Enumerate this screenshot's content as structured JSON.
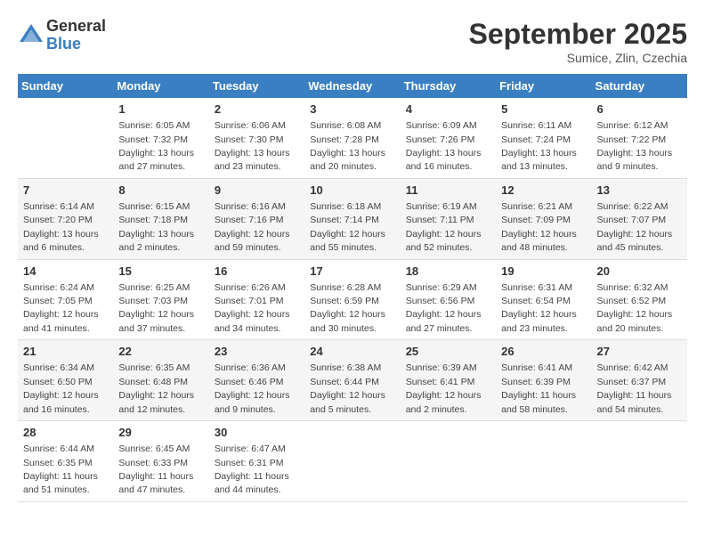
{
  "logo": {
    "general": "General",
    "blue": "Blue"
  },
  "title": "September 2025",
  "location": "Sumice, Zlin, Czechia",
  "days_of_week": [
    "Sunday",
    "Monday",
    "Tuesday",
    "Wednesday",
    "Thursday",
    "Friday",
    "Saturday"
  ],
  "weeks": [
    [
      {
        "day": "",
        "info": ""
      },
      {
        "day": "1",
        "info": "Sunrise: 6:05 AM\nSunset: 7:32 PM\nDaylight: 13 hours\nand 27 minutes."
      },
      {
        "day": "2",
        "info": "Sunrise: 6:06 AM\nSunset: 7:30 PM\nDaylight: 13 hours\nand 23 minutes."
      },
      {
        "day": "3",
        "info": "Sunrise: 6:08 AM\nSunset: 7:28 PM\nDaylight: 13 hours\nand 20 minutes."
      },
      {
        "day": "4",
        "info": "Sunrise: 6:09 AM\nSunset: 7:26 PM\nDaylight: 13 hours\nand 16 minutes."
      },
      {
        "day": "5",
        "info": "Sunrise: 6:11 AM\nSunset: 7:24 PM\nDaylight: 13 hours\nand 13 minutes."
      },
      {
        "day": "6",
        "info": "Sunrise: 6:12 AM\nSunset: 7:22 PM\nDaylight: 13 hours\nand 9 minutes."
      }
    ],
    [
      {
        "day": "7",
        "info": "Sunrise: 6:14 AM\nSunset: 7:20 PM\nDaylight: 13 hours\nand 6 minutes."
      },
      {
        "day": "8",
        "info": "Sunrise: 6:15 AM\nSunset: 7:18 PM\nDaylight: 13 hours\nand 2 minutes."
      },
      {
        "day": "9",
        "info": "Sunrise: 6:16 AM\nSunset: 7:16 PM\nDaylight: 12 hours\nand 59 minutes."
      },
      {
        "day": "10",
        "info": "Sunrise: 6:18 AM\nSunset: 7:14 PM\nDaylight: 12 hours\nand 55 minutes."
      },
      {
        "day": "11",
        "info": "Sunrise: 6:19 AM\nSunset: 7:11 PM\nDaylight: 12 hours\nand 52 minutes."
      },
      {
        "day": "12",
        "info": "Sunrise: 6:21 AM\nSunset: 7:09 PM\nDaylight: 12 hours\nand 48 minutes."
      },
      {
        "day": "13",
        "info": "Sunrise: 6:22 AM\nSunset: 7:07 PM\nDaylight: 12 hours\nand 45 minutes."
      }
    ],
    [
      {
        "day": "14",
        "info": "Sunrise: 6:24 AM\nSunset: 7:05 PM\nDaylight: 12 hours\nand 41 minutes."
      },
      {
        "day": "15",
        "info": "Sunrise: 6:25 AM\nSunset: 7:03 PM\nDaylight: 12 hours\nand 37 minutes."
      },
      {
        "day": "16",
        "info": "Sunrise: 6:26 AM\nSunset: 7:01 PM\nDaylight: 12 hours\nand 34 minutes."
      },
      {
        "day": "17",
        "info": "Sunrise: 6:28 AM\nSunset: 6:59 PM\nDaylight: 12 hours\nand 30 minutes."
      },
      {
        "day": "18",
        "info": "Sunrise: 6:29 AM\nSunset: 6:56 PM\nDaylight: 12 hours\nand 27 minutes."
      },
      {
        "day": "19",
        "info": "Sunrise: 6:31 AM\nSunset: 6:54 PM\nDaylight: 12 hours\nand 23 minutes."
      },
      {
        "day": "20",
        "info": "Sunrise: 6:32 AM\nSunset: 6:52 PM\nDaylight: 12 hours\nand 20 minutes."
      }
    ],
    [
      {
        "day": "21",
        "info": "Sunrise: 6:34 AM\nSunset: 6:50 PM\nDaylight: 12 hours\nand 16 minutes."
      },
      {
        "day": "22",
        "info": "Sunrise: 6:35 AM\nSunset: 6:48 PM\nDaylight: 12 hours\nand 12 minutes."
      },
      {
        "day": "23",
        "info": "Sunrise: 6:36 AM\nSunset: 6:46 PM\nDaylight: 12 hours\nand 9 minutes."
      },
      {
        "day": "24",
        "info": "Sunrise: 6:38 AM\nSunset: 6:44 PM\nDaylight: 12 hours\nand 5 minutes."
      },
      {
        "day": "25",
        "info": "Sunrise: 6:39 AM\nSunset: 6:41 PM\nDaylight: 12 hours\nand 2 minutes."
      },
      {
        "day": "26",
        "info": "Sunrise: 6:41 AM\nSunset: 6:39 PM\nDaylight: 11 hours\nand 58 minutes."
      },
      {
        "day": "27",
        "info": "Sunrise: 6:42 AM\nSunset: 6:37 PM\nDaylight: 11 hours\nand 54 minutes."
      }
    ],
    [
      {
        "day": "28",
        "info": "Sunrise: 6:44 AM\nSunset: 6:35 PM\nDaylight: 11 hours\nand 51 minutes."
      },
      {
        "day": "29",
        "info": "Sunrise: 6:45 AM\nSunset: 6:33 PM\nDaylight: 11 hours\nand 47 minutes."
      },
      {
        "day": "30",
        "info": "Sunrise: 6:47 AM\nSunset: 6:31 PM\nDaylight: 11 hours\nand 44 minutes."
      },
      {
        "day": "",
        "info": ""
      },
      {
        "day": "",
        "info": ""
      },
      {
        "day": "",
        "info": ""
      },
      {
        "day": "",
        "info": ""
      }
    ]
  ]
}
